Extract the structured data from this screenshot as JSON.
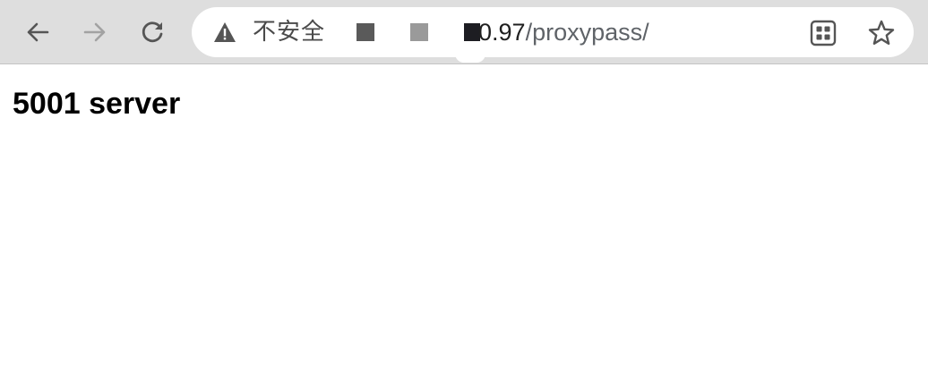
{
  "browser": {
    "security_label": "不安全",
    "url_host_visible": "0.97",
    "url_path": "/proxypass/",
    "icons": {
      "back": "arrow-left",
      "forward": "arrow-right",
      "reload": "reload",
      "security": "warning-triangle",
      "qr": "qr-code",
      "bookmark": "star-outline"
    }
  },
  "page": {
    "heading": "5001 server"
  }
}
